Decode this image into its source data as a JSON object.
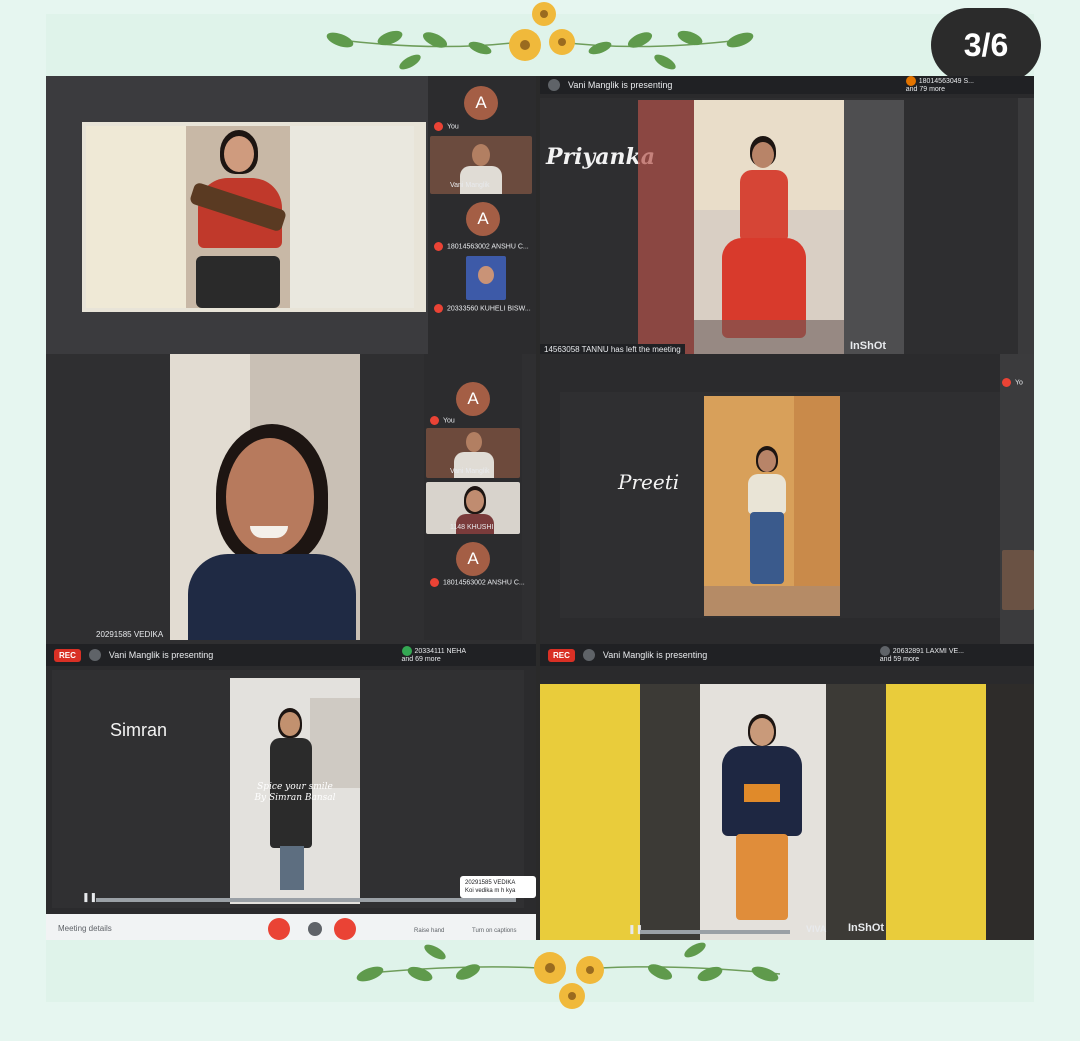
{
  "counter": {
    "label": "3/6"
  },
  "tiles": {
    "t1": {
      "self_label": "You",
      "avatar_letter": "A",
      "p1": "Vani Manglik",
      "avatar2_letter": "A",
      "p2": "18014563002 ANSHU C...",
      "p3": "20333560 KUHELI BISW..."
    },
    "t2": {
      "presenting": "Vani Manglik is presenting",
      "participants_line1": "18014563049 S...",
      "participants_line2": "and 79 more",
      "name": "Priyanka",
      "left_msg": "14563058 TANNU has left the meeting",
      "watermark": "InShOt"
    },
    "t3": {
      "avatar_letter": "A",
      "self_label": "You",
      "p1": "Vani Manglik",
      "p2": "1148 KHUSHI",
      "avatar2_letter": "A",
      "p3": "18014563002 ANSHU C...",
      "footer": "20291585 VEDIKA"
    },
    "t4": {
      "name": "Preeti",
      "side_label": "Yo"
    },
    "t5": {
      "rec": "REC",
      "presenting": "Vani Manglik is presenting",
      "participants_line1": "20334111 NEHA",
      "participants_line2": "and 69 more",
      "name": "Simran",
      "overlay_line1": "Spice your smile",
      "overlay_line2": "By Simran Bansal",
      "notif_line1": "20291585 VEDIKA",
      "notif_line2": "Koi vedika m h kya",
      "meeting_details": "Meeting details",
      "raise_hand": "Raise hand",
      "captions": "Turn on captions"
    },
    "t6": {
      "rec": "REC",
      "presenting": "Vani Manglik is presenting",
      "participants_line1": "20632891 LAXMI VE...",
      "participants_line2": "and 59 more",
      "watermark1": "VIVA",
      "watermark2": "InShOt"
    }
  },
  "colors": {
    "background": "#e6f6f0",
    "meet_dark": "#202124",
    "rec_red": "#d93025",
    "avatar": "#a45e45",
    "yellow_wall": "#e9cc3b"
  },
  "decorations": {
    "top": "sunflower-garland-icon",
    "bottom": "sunflower-garland-icon"
  }
}
